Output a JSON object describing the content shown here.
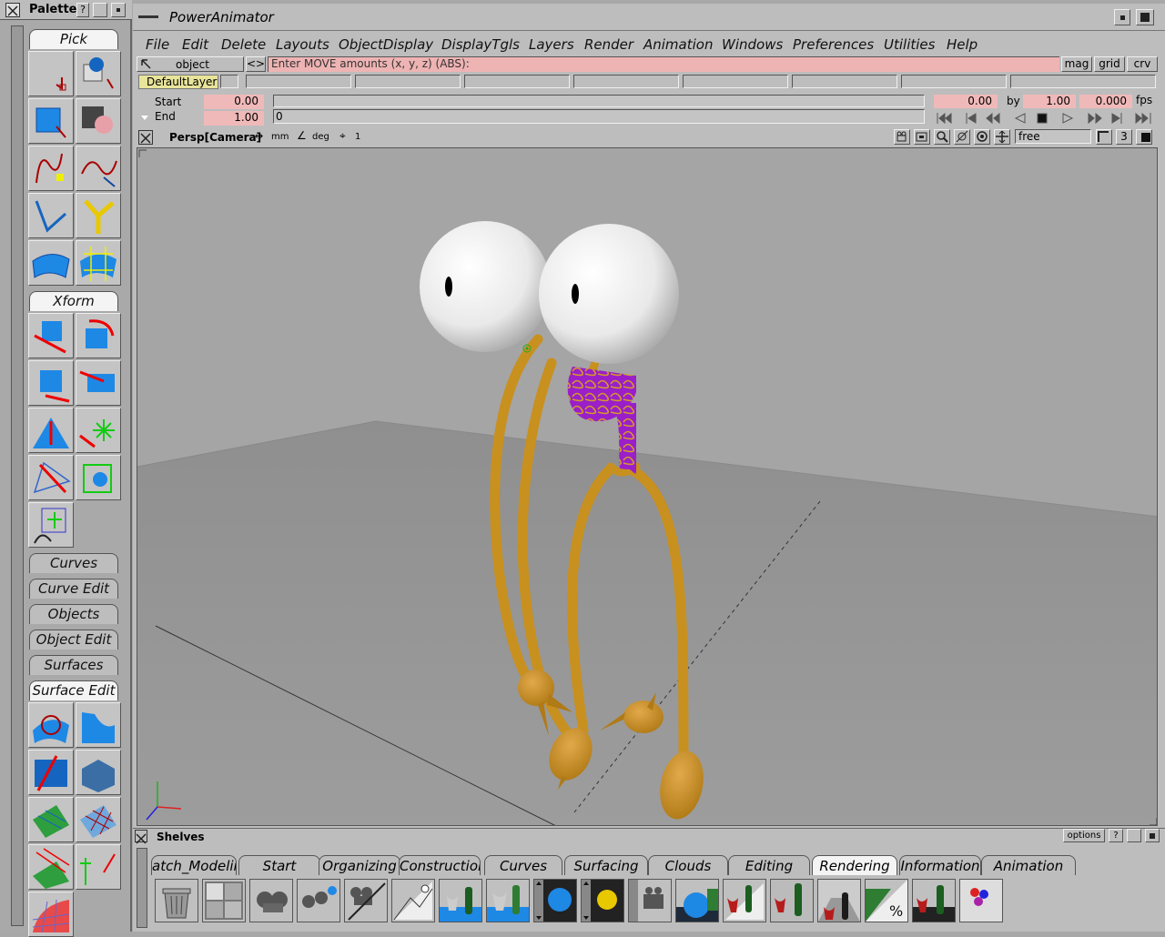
{
  "palette": {
    "title": "Palette",
    "help_label": "?",
    "sections": {
      "pick": "Pick",
      "xform": "Xform",
      "curves": "Curves",
      "curve_edit": "Curve Edit",
      "objects": "Objects",
      "object_edit": "Object Edit",
      "surfaces": "Surfaces",
      "surface_edit": "Surface Edit"
    }
  },
  "window": {
    "title": "PowerAnimator"
  },
  "menu": [
    "File",
    "Edit",
    "Delete",
    "Layouts",
    "ObjectDisplay",
    "DisplayTgls",
    "Layers",
    "Render",
    "Animation",
    "Windows",
    "Preferences",
    "Utilities",
    "Help"
  ],
  "promptline": {
    "mode": "object",
    "toggle": "<>",
    "prompt": "Enter MOVE amounts (x, y, z) (ABS):",
    "mag": "mag",
    "grid": "grid",
    "crv": "crv"
  },
  "layers": {
    "default": "DefaultLayer"
  },
  "time": {
    "start_label": "Start",
    "end_label": "End",
    "start_value": "0.00",
    "end_value": "1.00",
    "slider_value": "0",
    "current": "0.00",
    "by_label": "by",
    "by_value": "1.00",
    "fps_value": "0.000",
    "fps_label": "fps"
  },
  "viewport": {
    "name": "Persp[Camera]",
    "units_linear": "mm",
    "units_angle": "deg",
    "snap": "1",
    "camera_mode": "free",
    "view_count": "3"
  },
  "shelves": {
    "title": "Shelves",
    "options": "options",
    "help": "?",
    "tabs": [
      "atch_Modelin",
      "Start",
      "Organizing",
      "Construction",
      "Curves",
      "Surfacing",
      "Clouds",
      "Editing",
      "Rendering",
      "Information",
      "Animation"
    ],
    "active_tab": "Rendering"
  },
  "colors": {
    "ui_gray": "#bdbdbd",
    "prompt_pink": "#eeb3b3",
    "body_orange": "#c8901e",
    "neck_purple": "#9a1fc8"
  }
}
